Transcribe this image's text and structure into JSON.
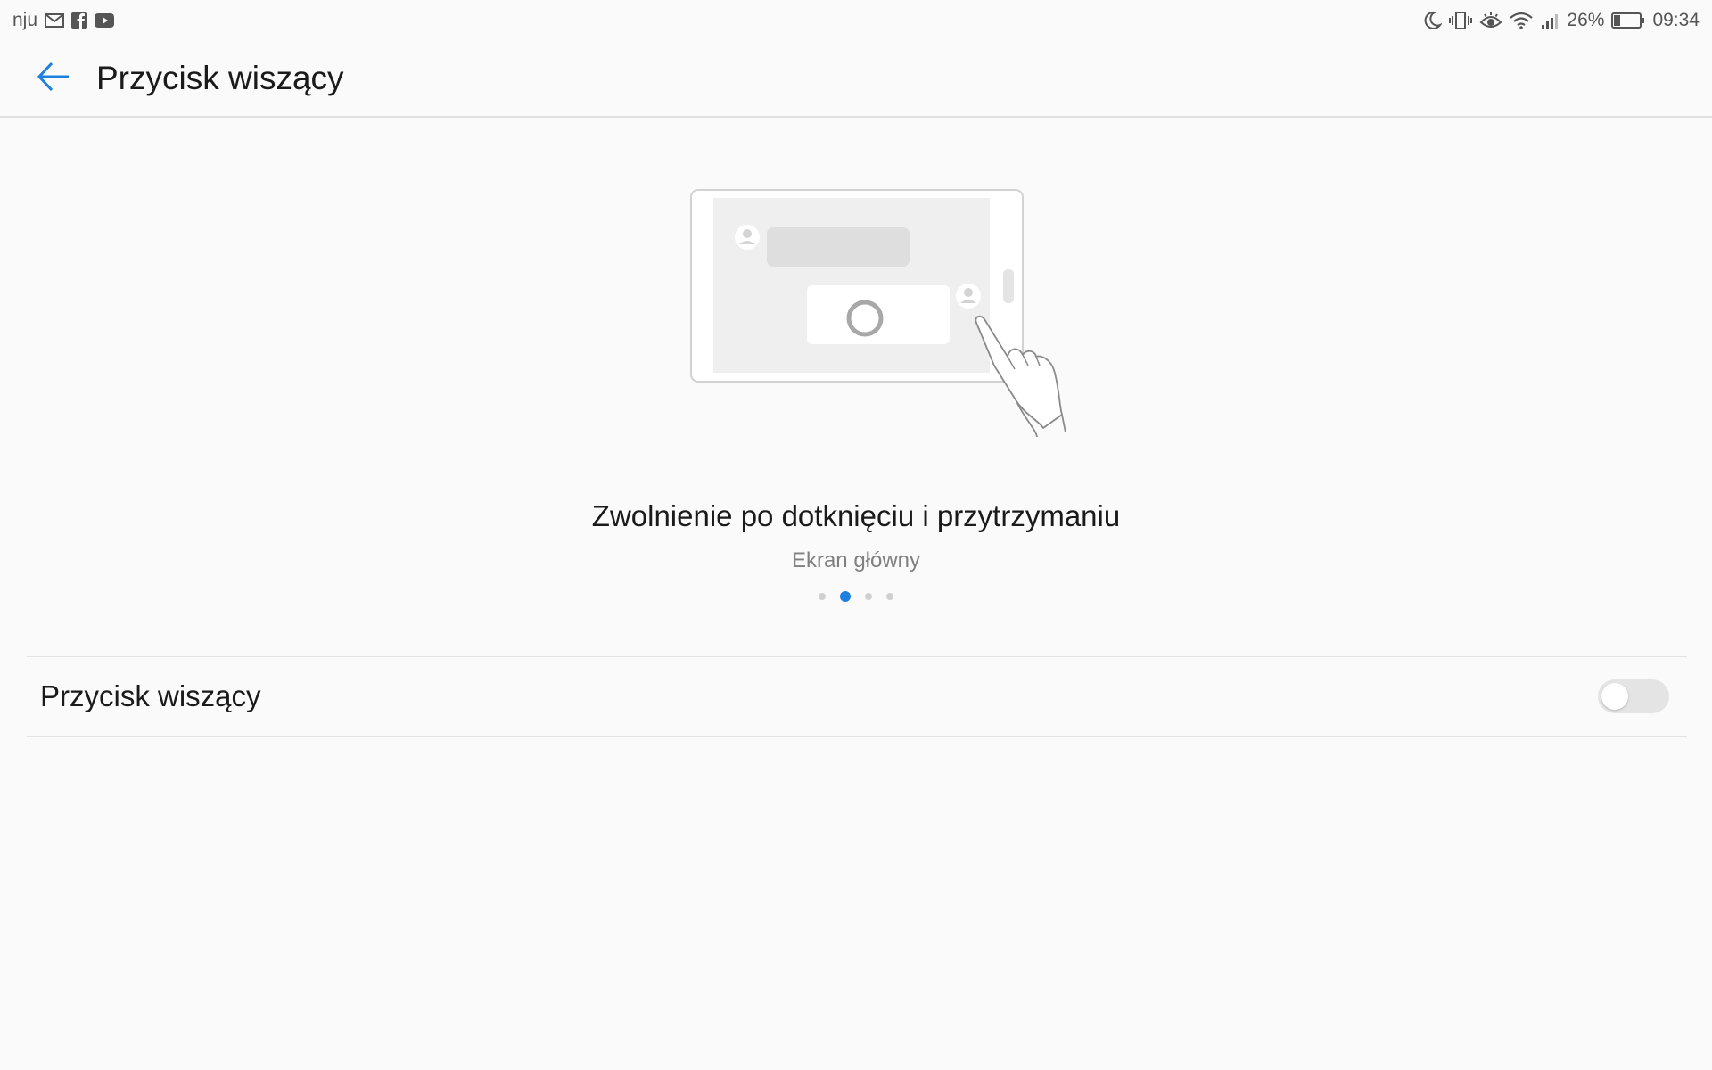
{
  "status_bar": {
    "carrier": "nju",
    "left_icons": [
      "gmail-icon",
      "facebook-icon",
      "youtube-icon"
    ],
    "right_icons": [
      "moon-icon",
      "vibrate-icon",
      "eye-comfort-icon",
      "wifi-icon",
      "signal-icon"
    ],
    "battery_percent": "26%",
    "battery_level": 0.26,
    "time": "09:34"
  },
  "app_bar": {
    "back_icon": "arrow-left-icon",
    "title": "Przycisk wiszący"
  },
  "tutorial": {
    "title": "Zwolnienie po dotknięciu i przytrzymaniu",
    "subtitle": "Ekran główny",
    "page_count": 4,
    "active_page": 2
  },
  "settings": {
    "floating_button_label": "Przycisk wiszący",
    "floating_button_enabled": false
  },
  "colors": {
    "accent": "#1e7fdf",
    "background": "#fafafa",
    "toggle_off": "#e4e4e4"
  }
}
